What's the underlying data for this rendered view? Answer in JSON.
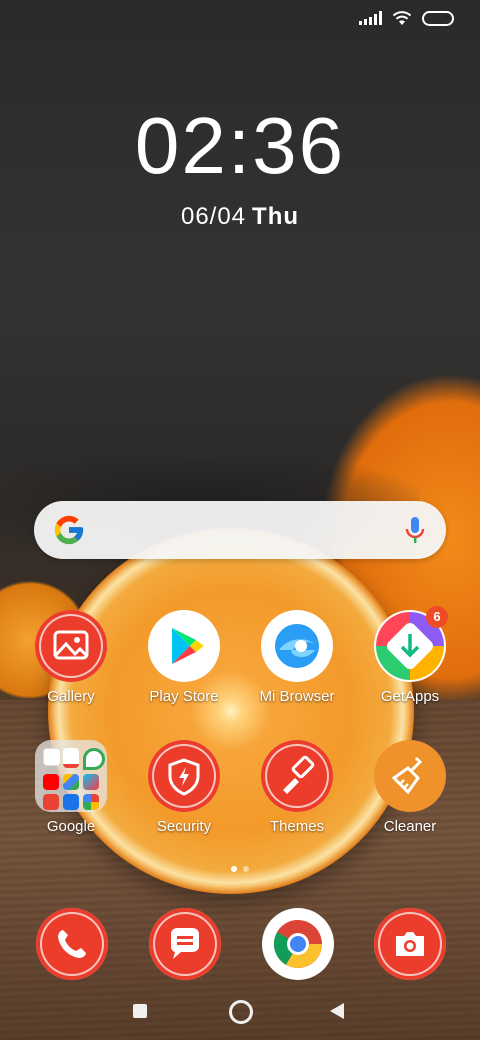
{
  "status_bar": {
    "signal_icon": "signal-icon",
    "wifi_icon": "wifi-icon",
    "battery_icon": "battery-icon"
  },
  "clock": {
    "time": "02:36",
    "date": "06/04",
    "weekday": "Thu"
  },
  "search": {
    "logo": "google-logo",
    "mic": "mic-icon"
  },
  "apps": [
    {
      "label": "Gallery",
      "icon": "gallery-icon"
    },
    {
      "label": "Play Store",
      "icon": "play-store-icon"
    },
    {
      "label": "Mi Browser",
      "icon": "mi-browser-icon"
    },
    {
      "label": "GetApps",
      "icon": "getapps-icon",
      "badge": "6"
    },
    {
      "label": "Google",
      "icon": "google-folder-icon"
    },
    {
      "label": "Security",
      "icon": "security-icon"
    },
    {
      "label": "Themes",
      "icon": "themes-icon"
    },
    {
      "label": "Cleaner",
      "icon": "cleaner-icon"
    }
  ],
  "page_indicator": {
    "pages": 2,
    "active": 1
  },
  "dock": [
    {
      "icon": "phone-icon"
    },
    {
      "icon": "messages-icon"
    },
    {
      "icon": "chrome-icon"
    },
    {
      "icon": "camera-icon"
    }
  ],
  "nav": {
    "recents": "recents-button",
    "home": "home-button",
    "back": "back-button"
  },
  "colors": {
    "app_red": "#ec3d2c",
    "cleaner_orange": "#f0922b",
    "badge": "#ee4b26"
  }
}
